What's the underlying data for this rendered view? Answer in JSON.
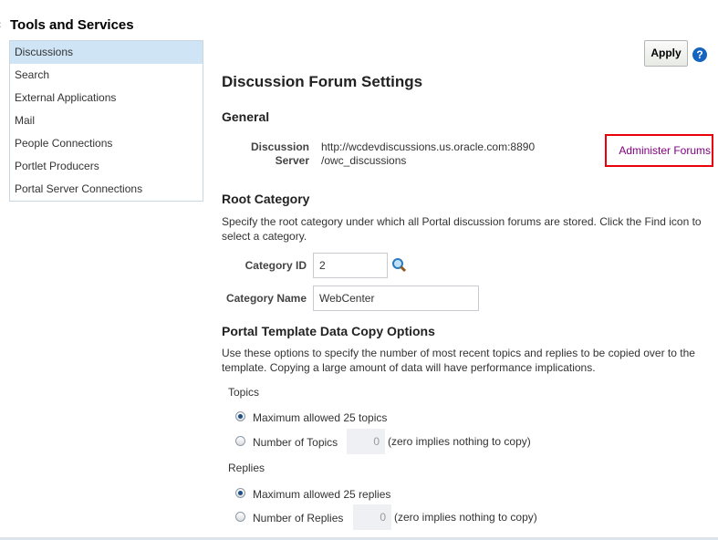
{
  "sidebar": {
    "title": "Tools and Services",
    "items": [
      {
        "label": "Discussions",
        "selected": true
      },
      {
        "label": "Search"
      },
      {
        "label": "External Applications"
      },
      {
        "label": "Mail"
      },
      {
        "label": "People Connections"
      },
      {
        "label": "Portlet Producers"
      },
      {
        "label": "Portal Server Connections"
      }
    ]
  },
  "toolbar": {
    "apply": "Apply",
    "help": "?"
  },
  "main": {
    "title": "Discussion Forum Settings",
    "general": {
      "heading": "General",
      "server_label_1": "Discussion",
      "server_label_2": "Server",
      "server_value_1": "http://wcdevdiscussions.us.oracle.com:8890",
      "server_value_2": "/owc_discussions",
      "admin_link": "Administer Forums"
    },
    "root": {
      "heading": "Root Category",
      "desc": "Specify the root category under which all Portal discussion forums are stored. Click the Find icon to select a category.",
      "id_label": "Category ID",
      "id_value": "2",
      "name_label": "Category Name",
      "name_value": "WebCenter"
    },
    "copy": {
      "heading": "Portal Template Data Copy Options",
      "desc": "Use these options to specify the number of most recent topics and replies to be copied over to the template. Copying a large amount of data will have performance implications.",
      "topics_label": "Topics",
      "topics_max": "Maximum allowed 25 topics",
      "topics_num": "Number of Topics",
      "topics_value": "0",
      "topics_hint": "(zero implies nothing to copy)",
      "replies_label": "Replies",
      "replies_max": "Maximum allowed 25 replies",
      "replies_num": "Number of Replies",
      "replies_value": "0",
      "replies_hint": "(zero implies nothing to copy)"
    }
  }
}
